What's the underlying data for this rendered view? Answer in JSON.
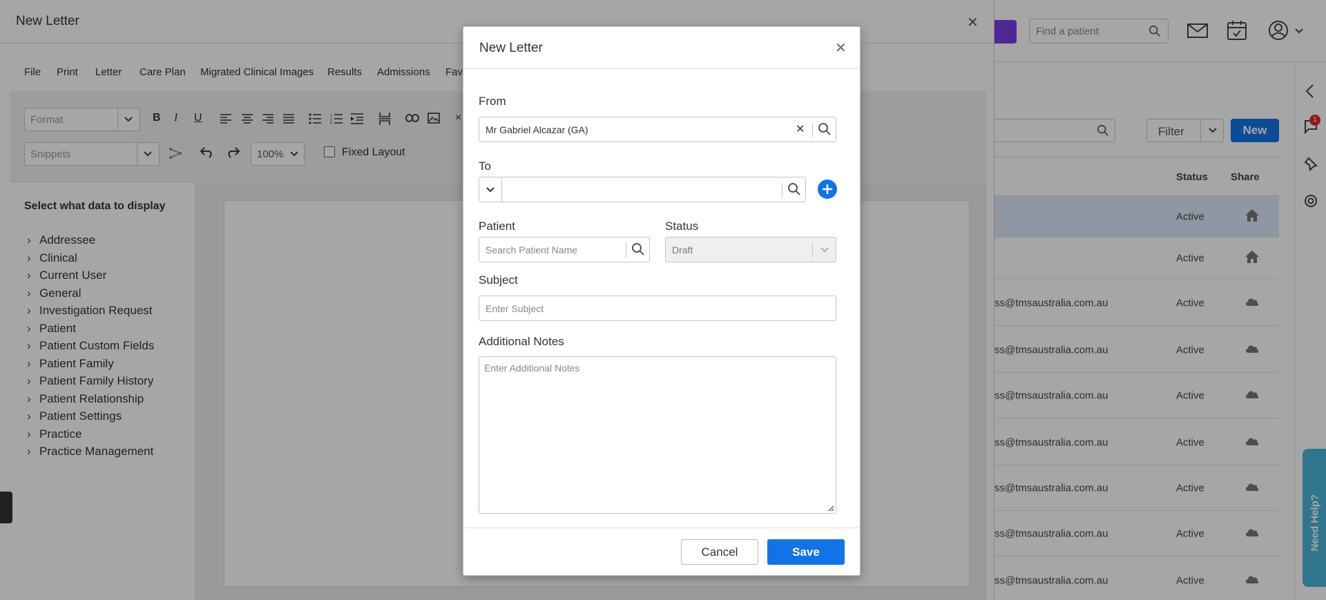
{
  "app": {
    "find_patient_placeholder": "Find a patient",
    "filter_label": "Filter",
    "new_label": "New",
    "notification_count": "1",
    "need_help_label": "Need Help?",
    "list_headers": {
      "status": "Status",
      "share": "Share"
    },
    "rows": [
      {
        "email": "",
        "status": "Active",
        "share_icon": "home-icon",
        "selected": true
      },
      {
        "email": "",
        "status": "Active",
        "share_icon": "home-icon",
        "selected": false
      },
      {
        "email": "ss@tmsaustralia.com.au",
        "status": "Active",
        "share_icon": "cloud-icon",
        "selected": false
      },
      {
        "email": "ss@tmsaustralia.com.au",
        "status": "Active",
        "share_icon": "cloud-icon",
        "selected": false
      },
      {
        "email": "ss@tmsaustralia.com.au",
        "status": "Active",
        "share_icon": "cloud-icon",
        "selected": false
      },
      {
        "email": "ss@tmsaustralia.com.au",
        "status": "Active",
        "share_icon": "cloud-icon",
        "selected": false
      },
      {
        "email": "ss@tmsaustralia.com.au",
        "status": "Active",
        "share_icon": "cloud-icon",
        "selected": false
      },
      {
        "email": "ss@tmsaustralia.com.au",
        "status": "Active",
        "share_icon": "cloud-icon",
        "selected": false
      },
      {
        "email": "ss@tmsaustralia.com.au",
        "status": "Active",
        "share_icon": "cloud-icon",
        "selected": false
      }
    ]
  },
  "editor": {
    "title": "New Letter",
    "menu": [
      "File",
      "Print",
      "Letter",
      "Care Plan",
      "Migrated Clinical Images",
      "Results",
      "Admissions",
      "Fav"
    ],
    "format_placeholder": "Format",
    "snippets_placeholder": "Snippets",
    "zoom": "100%",
    "fixed_layout_label": "Fixed Layout",
    "data_panel_title": "Select what data to display",
    "data_items": [
      "Addressee",
      "Clinical",
      "Current User",
      "General",
      "Investigation Request",
      "Patient",
      "Patient Custom Fields",
      "Patient Family",
      "Patient Family History",
      "Patient Relationship",
      "Patient Settings",
      "Practice",
      "Practice Management"
    ]
  },
  "modal": {
    "title": "New Letter",
    "from_label": "From",
    "from_value": "Mr Gabriel Alcazar (GA)",
    "to_label": "To",
    "to_value": "",
    "patient_label": "Patient",
    "patient_placeholder": "Search Patient Name",
    "status_label": "Status",
    "status_value": "Draft",
    "subject_label": "Subject",
    "subject_placeholder": "Enter Subject",
    "notes_label": "Additional Notes",
    "notes_placeholder": "Enter Additional Notes",
    "cancel_label": "Cancel",
    "save_label": "Save"
  },
  "colors": {
    "primary": "#1273e8",
    "accent_purple": "#7a3ee6",
    "badge_red": "#e0282c",
    "help_tab": "#49b4d6"
  }
}
